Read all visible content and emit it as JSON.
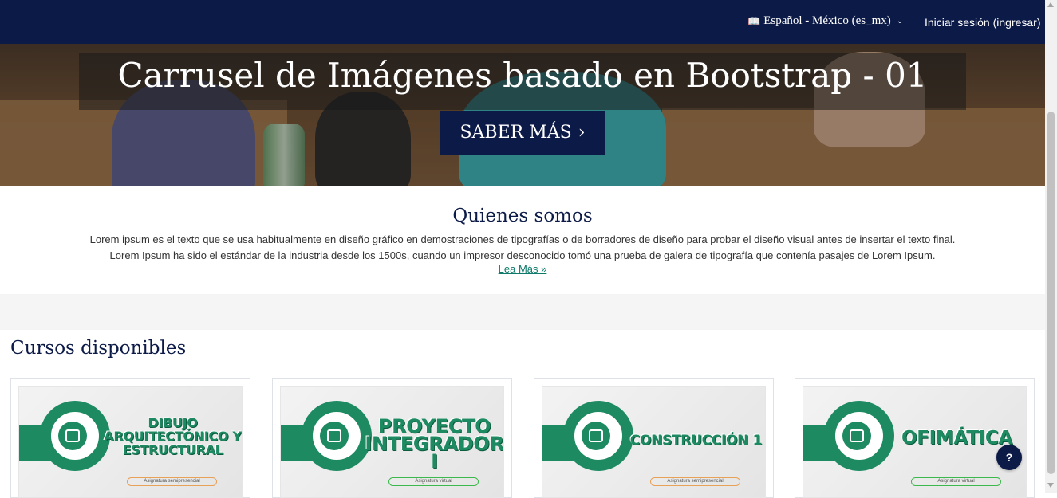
{
  "navbar": {
    "language_label": "Español - México (es_mx)",
    "login_label": "Iniciar sesión (ingresar)"
  },
  "hero": {
    "title": "Carrusel de Imágenes basado en Bootstrap - 01",
    "button_label": "SABER MÁS",
    "button_arrow": "›"
  },
  "about": {
    "heading": "Quienes somos",
    "body": "Lorem ipsum es el texto que se usa habitualmente en diseño gráfico en demostraciones de tipografías o de borradores de diseño para probar el diseño visual antes de insertar el texto final. Lorem Ipsum ha sido el estándar de la industria desde los 1500s, cuando un impresor desconocido tomó una prueba de galera de tipografía que contenía pasajes de Lorem Ipsum.",
    "link": "Lea Más »"
  },
  "courses": {
    "heading": "Cursos disponibles",
    "items": [
      {
        "title": "DIBUJO ARQUITECTÓNICO Y ESTRUCTURAL",
        "badge": "Asignatura semipresencial"
      },
      {
        "title": "PROYECTO INTEGRADOR I",
        "badge": "Asignatura virtual"
      },
      {
        "title": "CONSTRUCCIÓN 1",
        "badge": "Asignatura semipresencial"
      },
      {
        "title": "OFIMÁTICA",
        "badge": "Asignatura virtual"
      }
    ]
  },
  "help_button": "?",
  "colors": {
    "navbar": "#0c1a47",
    "accent_green": "#1d8a62",
    "link": "#0f7a6a"
  },
  "icons": [
    "translate-icon",
    "chevron-down-icon",
    "chevron-right-icon",
    "help-icon"
  ]
}
